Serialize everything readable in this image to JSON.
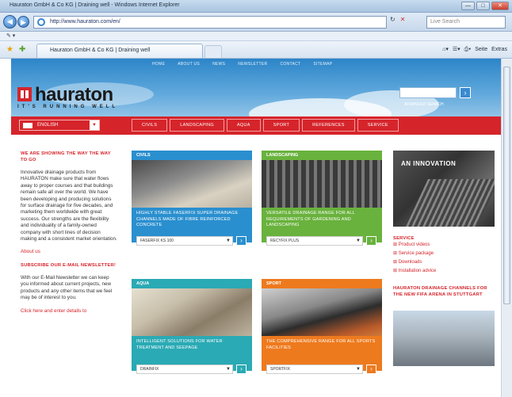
{
  "window": {
    "title": "Hauraton GmbH & Co KG | Draining well - Windows Internet Explorer",
    "address": "http://www.hauraton.com/en/",
    "search_placeholder": "Live Search",
    "tab_title": "Hauraton GmbH & Co KG | Draining well",
    "cmd_page": "Seite",
    "cmd_extras": "Extras",
    "btn_min": "—",
    "btn_max": "□",
    "btn_close": "✕"
  },
  "site": {
    "topnav": [
      "HOME",
      "ABOUT US",
      "NEWS",
      "NEWSLETTER",
      "CONTACT",
      "SITEMAP"
    ],
    "brand": "hauraton",
    "tagline": "IT'S RUNNING WELL",
    "search_link": "ADVANCED SEARCH",
    "language": "ENGLISH",
    "menu": [
      "CIVILS",
      "LANDSCAPING",
      "AQUA",
      "SPORT",
      "REFERENCES",
      "SERVICE"
    ]
  },
  "left": {
    "heading": "WE ARE SHOWING THE WAY THE WAY TO GO",
    "body": "Innovative drainage products from HAURATON make sure that water flows away to proper courses and that buildings remain safe all over the world. We have been developing and producing solutions for surface drainage for five decades, and marketing them worldwide with great success. Our strengths are the flexibility and individuality of a family-owned company with short lines of decision making and a consistent market orientation.",
    "about_link": "About us",
    "newsletter_heading": "SUBSCRIBE OUR E-MAIL NEWSLETTER!",
    "newsletter_body": "With our E-Mail Newsletter we can keep you informed about current projects, new products and any other items that we feel may be of interest to you.",
    "click_here": "Click here and enter details to"
  },
  "boxes": [
    {
      "label": "CIVILS",
      "text": "HIGHLY STABLE FASERFIX SUPER DRAINAGE CHANNELS MADE OF FIBRE REINFORCED CONCRETE",
      "select": "FASERFIX KS 100",
      "color": "#2a8fcf"
    },
    {
      "label": "LANDSCAPING",
      "text": "VERSATILE DRAINAGE RANGE FOR ALL REQUIREMENTS OF GARDENING AND LANDSCAPING",
      "select": "RECYFIX PLUS",
      "color": "#69b23d"
    },
    {
      "label": "AQUA",
      "text": "INTELLIGENT SOLUTIONS FOR WATER TREATMENT AND SEEPAGE",
      "select": "DRAINFIX",
      "color": "#2aaab4"
    },
    {
      "label": "SPORT",
      "text": "THE COMPREHENSIVE RANGE FOR ALL SPORTS FACILITIES",
      "select": "SPORTFIX",
      "color": "#ee7a1e"
    }
  ],
  "right": {
    "banner": "AN INNOVATION",
    "service_heading": "SERVICE",
    "service_links": [
      "Product videos",
      "Service package",
      "Downloads",
      "Installation advice"
    ],
    "news_heading": "HAURATON DRAINAGE CHANNELS FOR THE NEW FIFA ARENA IN STUTTGART"
  },
  "colors": {
    "brand_red": "#d6242b",
    "sky": "#2c85c8"
  }
}
